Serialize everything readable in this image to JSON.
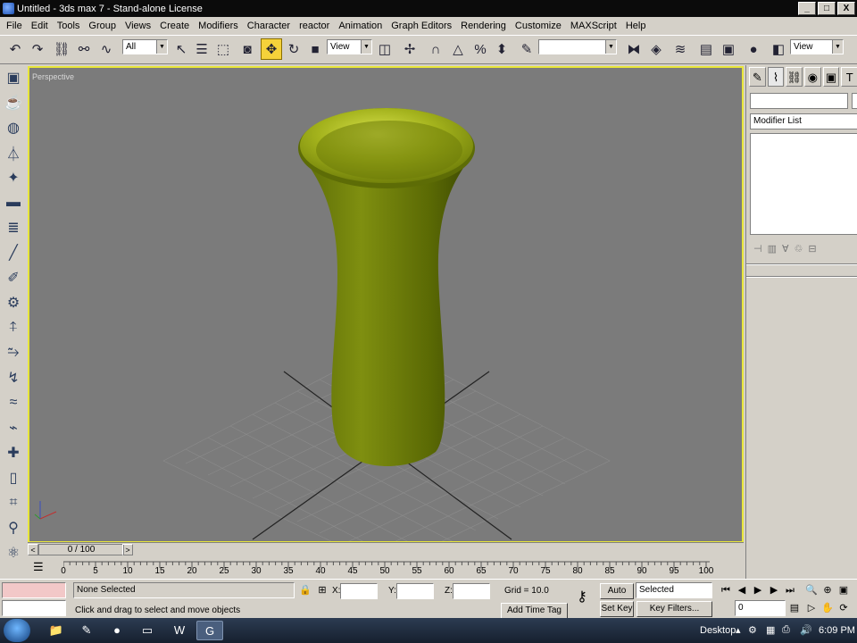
{
  "window": {
    "title": "Untitled - 3ds max 7 - Stand-alone License",
    "app_icon": "3ds-max-icon",
    "min_label": "_",
    "max_label": "□",
    "close_label": "X"
  },
  "menu": [
    "File",
    "Edit",
    "Tools",
    "Group",
    "Views",
    "Create",
    "Modifiers",
    "Character",
    "reactor",
    "Animation",
    "Graph Editors",
    "Rendering",
    "Customize",
    "MAXScript",
    "Help"
  ],
  "toolbar": {
    "selection_filter": "All",
    "ref_coord": "View",
    "named_sets": "",
    "view_dropdown": "View"
  },
  "viewport": {
    "label": "Perspective",
    "border_color": "#e8e63a",
    "background": "#7b7b7b",
    "object": "vase",
    "object_color": "#8a9a10"
  },
  "time_slider": {
    "value": "0 / 100",
    "left_arrow": "<",
    "right_arrow": ">"
  },
  "trackbar": {
    "ticks": [
      "0",
      "5",
      "10",
      "15",
      "20",
      "25",
      "30",
      "35",
      "40",
      "45",
      "50",
      "55",
      "60",
      "65",
      "70",
      "75",
      "80",
      "85",
      "90",
      "95",
      "100"
    ]
  },
  "status": {
    "selection": "None Selected",
    "prompt": "Click and drag to select and move objects",
    "x_label": "X:",
    "y_label": "Y:",
    "z_label": "Z:",
    "x_value": "",
    "y_value": "",
    "z_value": "",
    "grid": "Grid = 10.0",
    "add_time_tag": "Add Time Tag",
    "auto_key": "Auto Key",
    "set_key": "Set Key",
    "key_mode": "Selected",
    "key_filters": "Key Filters...",
    "frame": "0"
  },
  "command_panel": {
    "modifier_list": "Modifier List",
    "object_name": ""
  },
  "taskbar": {
    "desktop": "Desktop",
    "clock": "6:09 PM"
  },
  "colors": {
    "accent_active": "#f5d23a",
    "viewport_border": "#e8e63a"
  }
}
